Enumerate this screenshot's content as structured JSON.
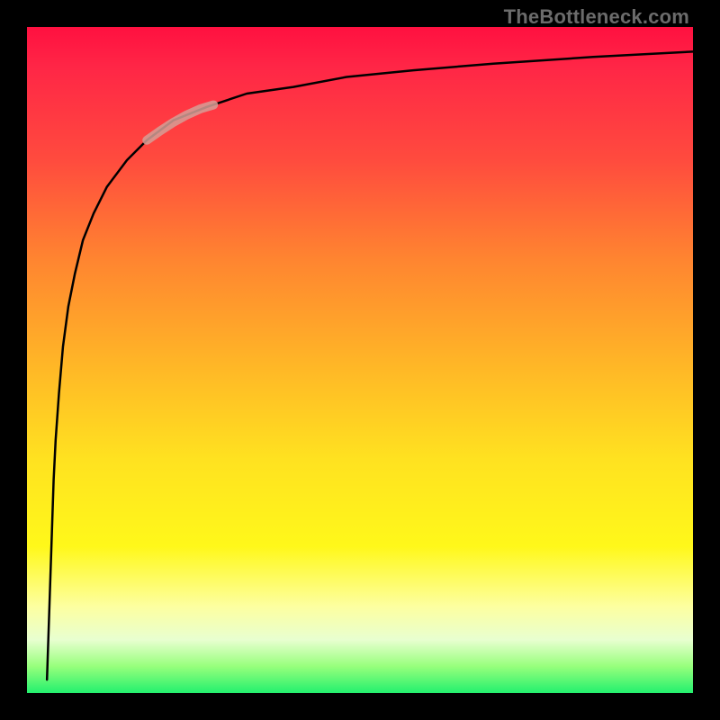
{
  "watermark": "TheBottleneck.com",
  "chart_data": {
    "type": "line",
    "title": "",
    "xlabel": "",
    "ylabel": "",
    "xlim": [
      0,
      100
    ],
    "ylim": [
      0,
      100
    ],
    "background_gradient": {
      "stops": [
        "#ff1040",
        "#ff8530",
        "#ffe220",
        "#fdffa0",
        "#23f06e"
      ],
      "direction": "top-to-bottom"
    },
    "series": [
      {
        "name": "curve",
        "stroke": "#000000",
        "x": [
          3,
          3.2,
          3.4,
          3.6,
          3.8,
          4.0,
          4.3,
          4.8,
          5.4,
          6.2,
          7.2,
          8.4,
          10,
          12,
          15,
          18,
          22,
          27,
          33,
          40,
          48,
          58,
          70,
          85,
          100
        ],
        "values": [
          2,
          8,
          14,
          20,
          26,
          32,
          38,
          45,
          52,
          58,
          63,
          68,
          72,
          76,
          80,
          83,
          86,
          88,
          90,
          91,
          92.5,
          93.5,
          94.5,
          95.5,
          96.3
        ]
      },
      {
        "name": "highlight-segment",
        "stroke": "#d59f96",
        "stroke_width": 10,
        "x": [
          18,
          20,
          22,
          24,
          26,
          28
        ],
        "values": [
          83,
          84.4,
          85.7,
          86.8,
          87.7,
          88.3
        ]
      }
    ]
  }
}
